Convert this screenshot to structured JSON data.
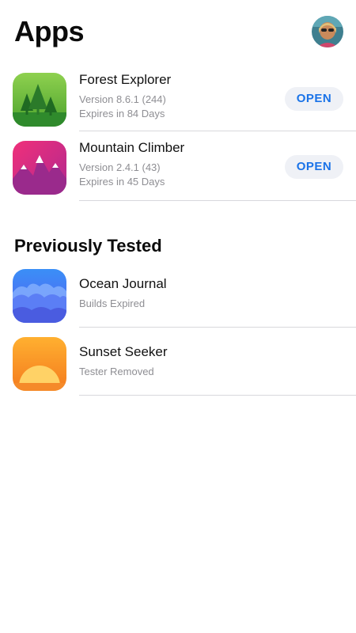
{
  "page": {
    "title": "Apps"
  },
  "apps": [
    {
      "name": "Forest Explorer",
      "version": "Version 8.6.1 (244)",
      "expires": "Expires in 84 Days",
      "button": "OPEN",
      "icon": "forest-icon"
    },
    {
      "name": "Mountain Climber",
      "version": "Version 2.4.1 (43)",
      "expires": "Expires in 45 Days",
      "button": "OPEN",
      "icon": "mountain-icon"
    }
  ],
  "previous": {
    "title": "Previously Tested",
    "items": [
      {
        "name": "Ocean Journal",
        "status": "Builds Expired",
        "icon": "ocean-icon"
      },
      {
        "name": "Sunset Seeker",
        "status": "Tester Removed",
        "icon": "sunset-icon"
      }
    ]
  },
  "colors": {
    "accent": "#1a73e8",
    "button_bg": "#eff1f6",
    "muted": "#8e8e93"
  }
}
